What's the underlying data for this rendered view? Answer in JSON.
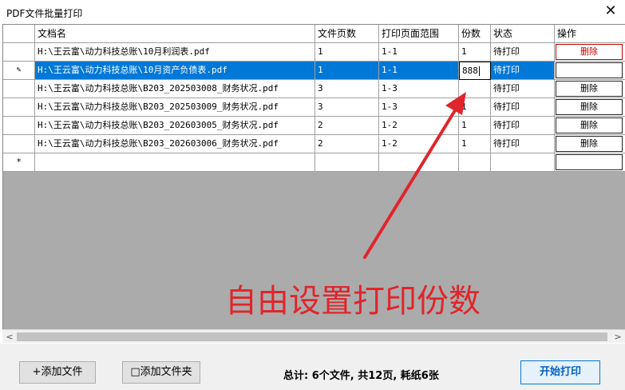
{
  "window": {
    "title": "PDF文件批量打印",
    "close_glyph": "✕"
  },
  "table": {
    "headers": {
      "name": "文档名",
      "pages": "文件页数",
      "range": "打印页面范围",
      "copies": "份数",
      "status": "状态",
      "action": "操作"
    },
    "rows": [
      {
        "marker": "",
        "name": "H:\\王云富\\动力科技总账\\10月利润表.pdf",
        "pages": "1",
        "range": "1-1",
        "copies": "1",
        "status": "待打印",
        "action": "删除"
      },
      {
        "marker": "✎",
        "name": "H:\\王云富\\动力科技总账\\10月资产负债表.pdf",
        "pages": "1",
        "range": "1-1",
        "copies": "888",
        "status": "待打印",
        "action": ""
      },
      {
        "marker": "",
        "name": "H:\\王云富\\动力科技总账\\B203_202503008_财务状况.pdf",
        "pages": "3",
        "range": "1-3",
        "copies": "",
        "status": "待打印",
        "action": "删除"
      },
      {
        "marker": "",
        "name": "H:\\王云富\\动力科技总账\\B203_202503009_财务状况.pdf",
        "pages": "3",
        "range": "1-3",
        "copies": "1",
        "status": "待打印",
        "action": "删除"
      },
      {
        "marker": "",
        "name": "H:\\王云富\\动力科技总账\\B203_202603005_财务状况.pdf",
        "pages": "2",
        "range": "1-2",
        "copies": "1",
        "status": "待打印",
        "action": "删除"
      },
      {
        "marker": "",
        "name": "H:\\王云富\\动力科技总账\\B203_202603006_财务状况.pdf",
        "pages": "2",
        "range": "1-2",
        "copies": "1",
        "status": "待打印",
        "action": "删除"
      }
    ],
    "new_row_marker": "*"
  },
  "scrollbar": {
    "left_arrow": "<",
    "right_arrow": ">"
  },
  "toolbar": {
    "add_file_label": "+添加文件",
    "add_folder_label": "□添加文件夹",
    "summary": "总计: 6个文件, 共12页, 耗纸6张",
    "start_print_label": "开始打印"
  },
  "annotation": {
    "text": "自由设置打印份数",
    "color": "#e0252b"
  },
  "colors": {
    "selection": "#0078d7",
    "delete_highlight": "#c00000",
    "grid_background": "#ababab"
  }
}
